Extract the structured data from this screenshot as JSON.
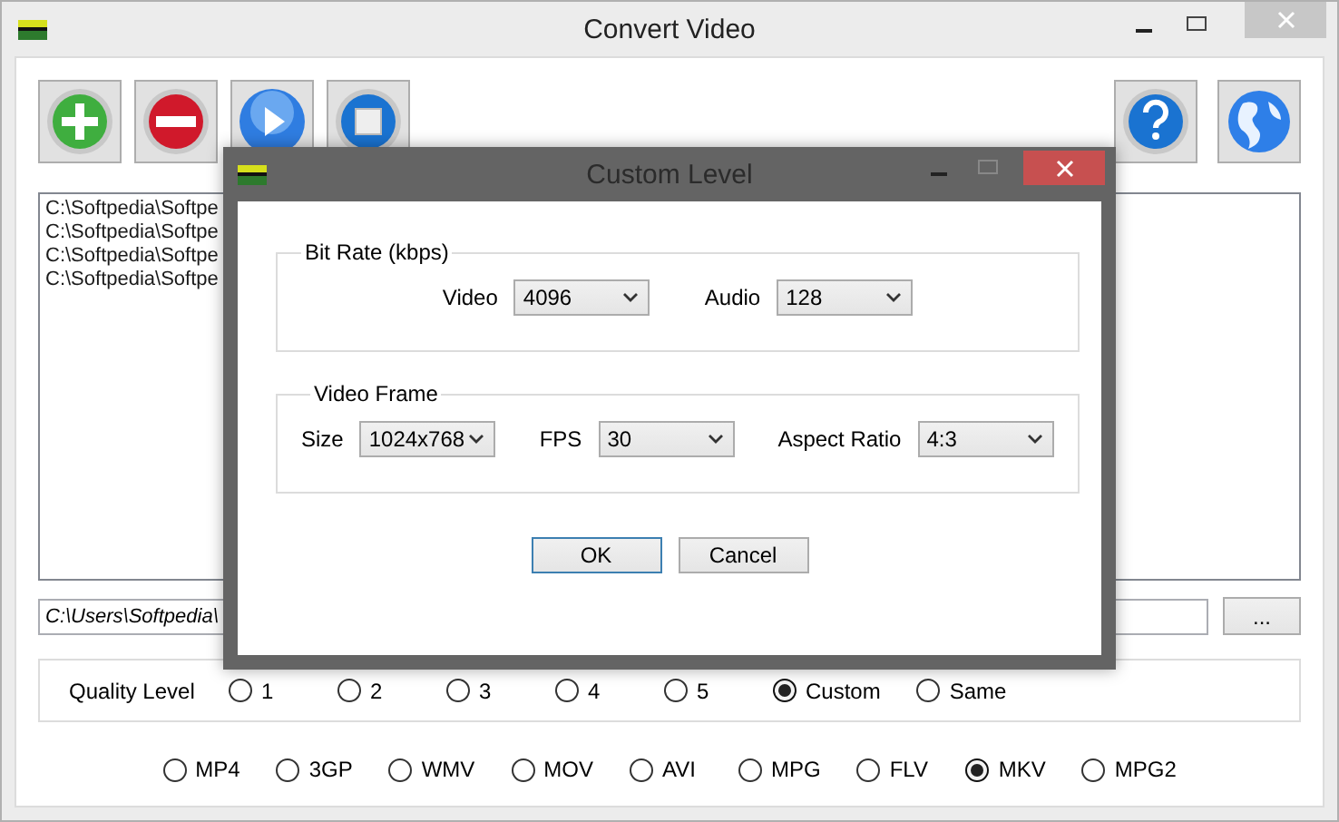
{
  "window": {
    "title": "Convert Video"
  },
  "files": [
    "C:\\Softpedia\\Softpe",
    "C:\\Softpedia\\Softpe",
    "C:\\Softpedia\\Softpe",
    "C:\\Softpedia\\Softpe"
  ],
  "output_path": {
    "value": "C:\\Users\\Softpedia\\"
  },
  "browse_button": "...",
  "quality": {
    "label": "Quality Level",
    "options": [
      {
        "label": "1",
        "selected": false
      },
      {
        "label": "2",
        "selected": false
      },
      {
        "label": "3",
        "selected": false
      },
      {
        "label": "4",
        "selected": false
      },
      {
        "label": "5",
        "selected": false
      },
      {
        "label": "Custom",
        "selected": true
      },
      {
        "label": "Same",
        "selected": false
      }
    ]
  },
  "formats": [
    {
      "label": "MP4",
      "selected": false
    },
    {
      "label": "3GP",
      "selected": false
    },
    {
      "label": "WMV",
      "selected": false
    },
    {
      "label": "MOV",
      "selected": false
    },
    {
      "label": "AVI",
      "selected": false
    },
    {
      "label": "MPG",
      "selected": false
    },
    {
      "label": "FLV",
      "selected": false
    },
    {
      "label": "MKV",
      "selected": true
    },
    {
      "label": "MPG2",
      "selected": false
    }
  ],
  "dialog": {
    "title": "Custom Level",
    "groups": [
      {
        "title": "Bit Rate (kbps)",
        "fields": [
          {
            "label": "Video",
            "value": "4096"
          },
          {
            "label": "Audio",
            "value": "128"
          }
        ]
      },
      {
        "title": "Video Frame",
        "fields": [
          {
            "label": "Size",
            "value": "1024x768"
          },
          {
            "label": "FPS",
            "value": "30"
          },
          {
            "label": "Aspect Ratio",
            "value": "4:3"
          }
        ]
      }
    ],
    "buttons": [
      {
        "label": "OK",
        "default": true
      },
      {
        "label": "Cancel",
        "default": false
      }
    ]
  }
}
